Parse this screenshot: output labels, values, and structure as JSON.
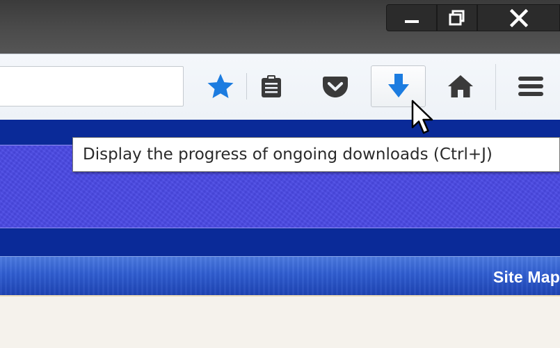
{
  "window_controls": {
    "minimize_icon": "minimize-icon",
    "maximize_icon": "restore-icon",
    "close_icon": "close-icon"
  },
  "toolbar": {
    "url_value": "",
    "buttons": [
      {
        "name": "bookmark-star-button",
        "icon": "star-icon",
        "color": "#1c7ce0"
      },
      {
        "name": "reading-list-button",
        "icon": "reading-list-icon",
        "color": "#3a3a3a"
      },
      {
        "name": "pocket-button",
        "icon": "pocket-icon",
        "color": "#3a3a3a"
      },
      {
        "name": "downloads-button",
        "icon": "download-arrow-icon",
        "color": "#1c7ce0",
        "state": "hovered"
      },
      {
        "name": "home-button",
        "icon": "home-icon",
        "color": "#3a3a3a"
      },
      {
        "name": "menu-button",
        "icon": "hamburger-menu-icon",
        "color": "#3a3a3a"
      }
    ]
  },
  "tooltip": {
    "text": "Display the progress of ongoing downloads (Ctrl+J)"
  },
  "page": {
    "nav_link": "Site Map",
    "colors": {
      "dark_band": "#0a2a98",
      "banner": "#4a49e4",
      "nav_strip": "#2f5dd0",
      "body_bg": "#f5f2ec"
    }
  }
}
